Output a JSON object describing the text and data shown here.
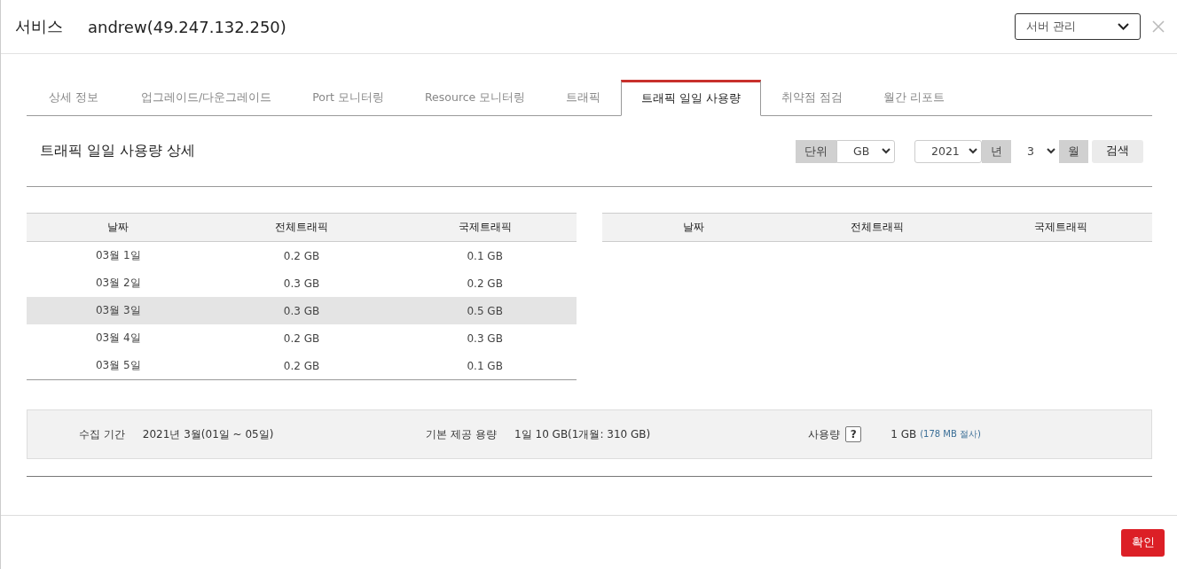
{
  "header": {
    "title": "서비스",
    "server": "andrew(49.247.132.250)",
    "dropdown": "서버 관리"
  },
  "tabs": [
    {
      "label": "상세 정보",
      "selected": false
    },
    {
      "label": "업그레이드/다운그레이드",
      "selected": false
    },
    {
      "label": "Port 모니터링",
      "selected": false
    },
    {
      "label": "Resource 모니터링",
      "selected": false
    },
    {
      "label": "트래픽",
      "selected": false
    },
    {
      "label": "트래픽 일일 사용량",
      "selected": true
    },
    {
      "label": "취약점 점검",
      "selected": false
    },
    {
      "label": "월간 리포트",
      "selected": false
    }
  ],
  "section": {
    "title": "트래픽 일일 사용량 상세",
    "unit_label": "단위",
    "unit": "GB",
    "year": "2021",
    "year_label": "년",
    "month": "3",
    "month_label": "월",
    "search": "검색"
  },
  "left_table": {
    "columns": [
      "날짜",
      "전체트래픽",
      "국제트래픽"
    ],
    "rows": [
      {
        "cells": [
          "03월 1일",
          "0.2 GB",
          "0.1 GB"
        ],
        "selected": false
      },
      {
        "cells": [
          "03월 2일",
          "0.3 GB",
          "0.2 GB"
        ],
        "selected": false
      },
      {
        "cells": [
          "03월 3일",
          "0.3 GB",
          "0.5 GB"
        ],
        "selected": true
      },
      {
        "cells": [
          "03월 4일",
          "0.2 GB",
          "0.3 GB"
        ],
        "selected": false
      },
      {
        "cells": [
          "03월 5일",
          "0.2 GB",
          "0.1 GB"
        ],
        "selected": false
      }
    ]
  },
  "right_table": {
    "columns": [
      "날짜",
      "전체트래픽",
      "국제트래픽"
    ]
  },
  "summary": {
    "period_label": "수집 기간",
    "period": "2021년 3월(01일 ~ 05일)",
    "quota_label": "기본 제공 용량",
    "quota": "1일 10 GB(1개월: 310 GB)",
    "usage_label": "사용량",
    "help": "?",
    "usage": "1 GB",
    "usage_note": "(178 MB 절사)"
  },
  "footer": {
    "confirm": "확인"
  }
}
